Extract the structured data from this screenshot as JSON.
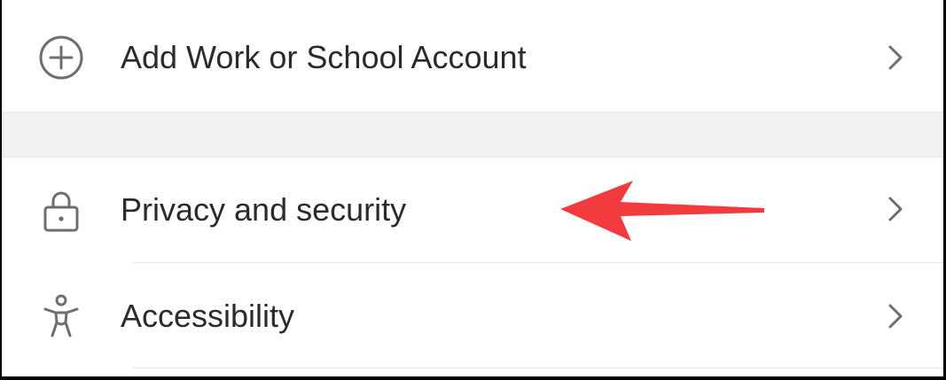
{
  "settings": {
    "items": [
      {
        "label": "Add Work or School Account",
        "icon": "plus-circle-icon"
      },
      {
        "label": "Privacy and security",
        "icon": "lock-icon"
      },
      {
        "label": "Accessibility",
        "icon": "accessibility-person-icon"
      }
    ]
  },
  "annotation": {
    "arrow_color": "#f23b3f"
  },
  "colors": {
    "text": "#2b2b2b",
    "icon": "#6e6e6e",
    "section_gap": "#f1f1f1",
    "divider": "#e4e4e4"
  }
}
